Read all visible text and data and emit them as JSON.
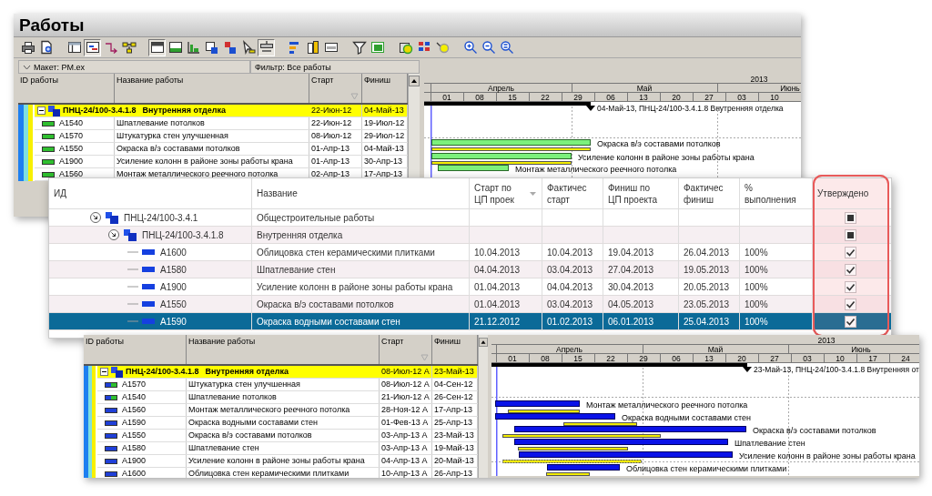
{
  "plan_window": {
    "title": "Работы",
    "toolbar": [
      [
        {
          "kind": "print",
          "pressed": false
        },
        {
          "kind": "preview",
          "pressed": false
        }
      ],
      [
        {
          "kind": "table",
          "pressed": false
        },
        {
          "kind": "gantt",
          "pressed": true
        },
        {
          "kind": "link",
          "pressed": false
        },
        {
          "kind": "network",
          "pressed": false
        }
      ],
      [
        {
          "kind": "layout_top",
          "pressed": true
        },
        {
          "kind": "layout_bottom",
          "pressed": false
        },
        {
          "kind": "layout_left",
          "pressed": false
        },
        {
          "kind": "resource",
          "pressed": false
        },
        {
          "kind": "resource_red",
          "pressed": false
        },
        {
          "kind": "pointer",
          "pressed": false
        },
        {
          "kind": "progress",
          "pressed": true
        }
      ],
      [
        {
          "kind": "bars",
          "pressed": false
        },
        {
          "kind": "columns",
          "pressed": false
        },
        {
          "kind": "form",
          "pressed": false
        }
      ],
      [
        {
          "kind": "filter",
          "pressed": false
        },
        {
          "kind": "filter_box",
          "pressed": false
        }
      ],
      [
        {
          "kind": "schedule",
          "pressed": false
        },
        {
          "kind": "levels",
          "pressed": false
        },
        {
          "kind": "highlight",
          "pressed": false
        }
      ],
      [
        {
          "kind": "zoom_in",
          "pressed": false
        },
        {
          "kind": "zoom_out",
          "pressed": false
        },
        {
          "kind": "zoom_fit",
          "pressed": false
        }
      ]
    ],
    "layout_label": "Макет: PM.ex",
    "filter_label": "Фильтр: Все работы",
    "columns": [
      "ID работы",
      "Название работы",
      "Старт",
      "Финиш"
    ],
    "rows": [
      {
        "id": "ПНЦ-24/100-3.4.1.8",
        "name": "Внутренняя отделка",
        "start": "22-Июн-12",
        "finish": "04-Май-13",
        "expanded": true,
        "children": [
          {
            "kind": "planned",
            "id": "A1540",
            "name": "Шпатлевание потолков",
            "start": "22-Июн-12",
            "finish": "19-Июл-12"
          },
          {
            "kind": "planned",
            "id": "A1570",
            "name": "Штукатурка стен улучшенная",
            "start": "08-Июл-12",
            "finish": "29-Июл-12"
          },
          {
            "kind": "planned",
            "id": "A1550",
            "name": "Окраска в/э составами потолков",
            "start": "01-Апр-13",
            "finish": "04-Май-13"
          },
          {
            "kind": "planned",
            "id": "A1900",
            "name": "Усиление колонн в районе зоны работы крана",
            "start": "01-Апр-13",
            "finish": "30-Апр-13"
          },
          {
            "kind": "planned",
            "id": "A1560",
            "name": "Монтаж металлического реечного потолка",
            "start": "02-Апр-13",
            "finish": "17-Апр-13"
          }
        ]
      }
    ],
    "gantt": {
      "year": "2013",
      "months": [
        "Апрель",
        "Май",
        "Июнь"
      ],
      "weeks": [
        "01",
        "08",
        "15",
        "22",
        "29",
        "06",
        "13",
        "20",
        "27",
        "03",
        "10"
      ],
      "kind": "remaining",
      "summary_label": "04-Май-13, ПНЦ-24/100-3.4.1.8  Внутренняя отделка",
      "bar_labels": [
        "Окраска в/э составами потолков",
        "Усиление колонн в районе зоны работы крана",
        "Монтаж металлического реечного потолка"
      ]
    }
  },
  "approval_window": {
    "columns": [
      "ИД",
      "Название",
      "Старт по\nЦП проек",
      "Фактичес\nстарт",
      "Финиш по\nЦП проекта",
      "Фактичес\nфиниш",
      "%\nвыполнения",
      "Утверждено"
    ],
    "rows": [
      {
        "id": "ПНЦ-24/100-3.4.1",
        "name": "Общестроительные работы",
        "expanded": true,
        "checked": false,
        "partial": true,
        "selected": false,
        "children": [
          {
            "id": "ПНЦ-24/100-3.4.1.8",
            "name": "Внутренняя отделка",
            "expanded": true,
            "checked": false,
            "partial": true,
            "selected": false,
            "children": [
              {
                "id": "A1600",
                "name": "Облицовка стен керамическими плитками",
                "plan_start": "10.04.2013",
                "actual_start": "10.04.2013",
                "plan_finish": "19.04.2013",
                "actual_finish": "26.04.2013",
                "percent": "100%",
                "checked": true,
                "partial": false,
                "selected": false
              },
              {
                "id": "A1580",
                "name": "Шпатлевание стен",
                "plan_start": "04.04.2013",
                "actual_start": "03.04.2013",
                "plan_finish": "27.04.2013",
                "actual_finish": "19.05.2013",
                "percent": "100%",
                "checked": true,
                "partial": false,
                "selected": false
              },
              {
                "id": "A1900",
                "name": "Усиление колонн в районе зоны работы крана",
                "plan_start": "01.04.2013",
                "actual_start": "04.04.2013",
                "plan_finish": "30.04.2013",
                "actual_finish": "20.05.2013",
                "percent": "100%",
                "checked": true,
                "partial": false,
                "selected": false
              },
              {
                "id": "A1550",
                "name": "Окраска в/э составами потолков",
                "plan_start": "01.04.2013",
                "actual_start": "03.04.2013",
                "plan_finish": "04.05.2013",
                "actual_finish": "23.05.2013",
                "percent": "100%",
                "checked": true,
                "partial": false,
                "selected": false
              },
              {
                "id": "A1590",
                "name": "Окраска водными составами стен",
                "plan_start": "21.12.2012",
                "actual_start": "01.02.2013",
                "plan_finish": "06.01.2013",
                "actual_finish": "25.04.2013",
                "percent": "100%",
                "checked": true,
                "partial": false,
                "selected": true
              }
            ]
          }
        ]
      }
    ]
  },
  "schedule_window": {
    "columns": [
      "ID работы",
      "Название работы",
      "Старт",
      "Финиш"
    ],
    "rows": [
      {
        "id": "ПНЦ-24/100-3.4.1.8",
        "name": "Внутренняя отделка",
        "start": "08-Июл-12 A",
        "finish": "23-Май-13",
        "expanded": true,
        "children": [
          {
            "kind": "completed",
            "id": "A1570",
            "name": "Штукатурка стен улучшенная",
            "start": "08-Июл-12 A",
            "finish": "04-Сен-12"
          },
          {
            "kind": "completed",
            "id": "A1540",
            "name": "Шпатлевание потолков",
            "start": "21-Июл-12 A",
            "finish": "26-Сен-12"
          },
          {
            "kind": "in_progress",
            "id": "A1560",
            "name": "Монтаж металлического реечного потолка",
            "start": "28-Ноя-12 A",
            "finish": "17-Апр-13"
          },
          {
            "kind": "in_progress",
            "id": "A1590",
            "name": "Окраска водными составами стен",
            "start": "01-Фев-13 A",
            "finish": "25-Апр-13"
          },
          {
            "kind": "in_progress",
            "id": "A1550",
            "name": "Окраска в/э составами потолков",
            "start": "03-Апр-13 A",
            "finish": "23-Май-13"
          },
          {
            "kind": "in_progress",
            "id": "A1580",
            "name": "Шпатлевание стен",
            "start": "03-Апр-13 A",
            "finish": "19-Май-13"
          },
          {
            "kind": "in_progress",
            "id": "A1900",
            "name": "Усиление колонн в районе зоны работы крана",
            "start": "04-Апр-13 A",
            "finish": "20-Май-13"
          },
          {
            "kind": "in_progress",
            "id": "A1600",
            "name": "Облицовка стен керамическими плитками",
            "start": "10-Апр-13 A",
            "finish": "26-Апр-13"
          }
        ]
      }
    ],
    "gantt": {
      "year": "2013",
      "months": [
        "Апрель",
        "Май",
        "Июнь"
      ],
      "weeks": [
        "01",
        "08",
        "15",
        "22",
        "29",
        "06",
        "13",
        "20",
        "27",
        "03",
        "10",
        "17",
        "24"
      ],
      "kind": "actual",
      "summary_label": "23-Май-13, ПНЦ-24/100-3.4.1.8  Внутренняя от",
      "bar_labels": [
        "Монтаж металлического реечного потолка",
        "Окраска водными составами стен",
        "Окраска в/э составами потолков",
        "Шпатлевание стен",
        "Усиление колонн в районе зоны работы крана",
        "Облицовка стен керамическими плитками"
      ]
    }
  }
}
